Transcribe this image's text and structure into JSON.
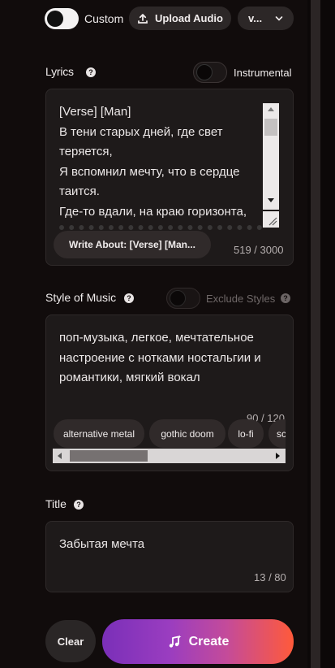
{
  "top": {
    "custom_label": "Custom",
    "upload_label": "Upload Audio",
    "version_label": "v..."
  },
  "lyrics": {
    "heading": "Lyrics",
    "instrumental_label": "Instrumental",
    "lines": [
      "[Verse] [Man]",
      "В тени старых дней, где свет",
      "теряется,",
      "Я вспомнил мечту, что в сердце",
      "таится.",
      "Где-то вдали, на краю горизонта,"
    ],
    "write_about_label": "Write About: [Verse] [Man...",
    "counter": "519 / 3000"
  },
  "style": {
    "heading": "Style of Music",
    "exclude_label": "Exclude Styles",
    "lines": [
      "поп-музыка, легкое, мечтательное",
      "настроение с нотками ностальгии и",
      "романтики, мягкий вокал"
    ],
    "counter": "90 / 120",
    "chips": [
      "alternative metal",
      "gothic doom",
      "lo-fi",
      "sc"
    ]
  },
  "title": {
    "heading": "Title",
    "value": "Забытая мечта",
    "counter": "13 / 80"
  },
  "actions": {
    "clear_label": "Clear",
    "create_label": "Create"
  }
}
